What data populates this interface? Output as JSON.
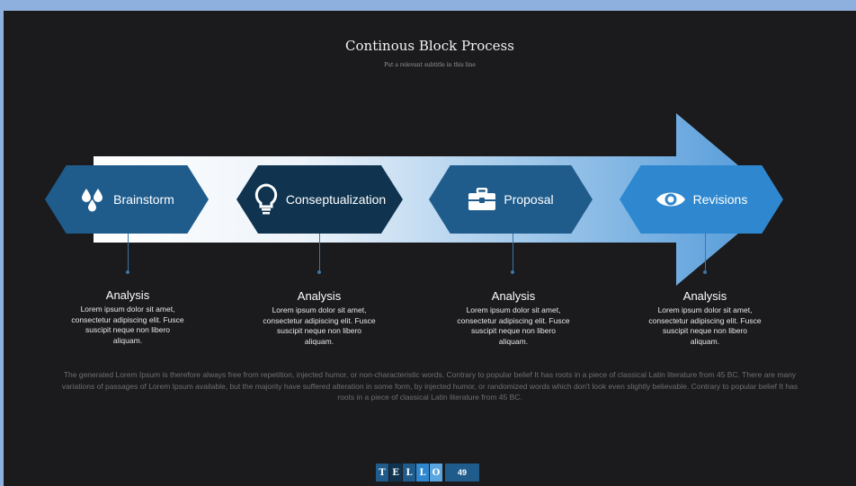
{
  "header": {
    "title": "Continous Block Process",
    "subtitle": "Put a relevant subtitle in this line"
  },
  "steps": [
    {
      "label": "Brainstorm",
      "icon": "drops-icon",
      "color": "#1f5c8c"
    },
    {
      "label": "Conseptualization",
      "icon": "lightbulb-icon",
      "color": "#10344f"
    },
    {
      "label": "Proposal",
      "icon": "briefcase-icon",
      "color": "#1f5c8c"
    },
    {
      "label": "Revisions",
      "icon": "eye-icon",
      "color": "#2f88cf"
    }
  ],
  "details": [
    {
      "heading": "Analysis",
      "text": "Lorem ipsum dolor sit amet, consectetur adipiscing elit. Fusce suscipit neque non libero aliquam."
    },
    {
      "heading": "Analysis",
      "text": "Lorem ipsum dolor sit amet, consectetur adipiscing elit. Fusce suscipit neque non libero aliquam."
    },
    {
      "heading": "Analysis",
      "text": "Lorem ipsum dolor sit amet, consectetur adipiscing elit. Fusce suscipit neque non libero aliquam."
    },
    {
      "heading": "Analysis",
      "text": "Lorem ipsum dolor sit amet, consectetur adipiscing elit. Fusce suscipit neque non libero aliquam."
    }
  ],
  "footer": {
    "text": "The generated Lorem Ipsum is therefore always free from repetition, injected humor, or non-characteristic words. Contrary to popular belief It has roots in a piece of classical Latin literature from 45 BC. There are many variations of passages of Lorem Ipsum available, but the majority have suffered alteration in some form, by injected humor, or randomized words which don't look even slightly believable. Contrary to popular belief It has roots in a piece of classical Latin literature from 45 BC."
  },
  "brand": {
    "letters": [
      "T",
      "E",
      "L",
      "L",
      "O"
    ],
    "letter_colors": [
      "#1f5c8c",
      "#10344f",
      "#1f5c8c",
      "#2f88cf",
      "#5aa6e0"
    ],
    "page_number": "49"
  }
}
